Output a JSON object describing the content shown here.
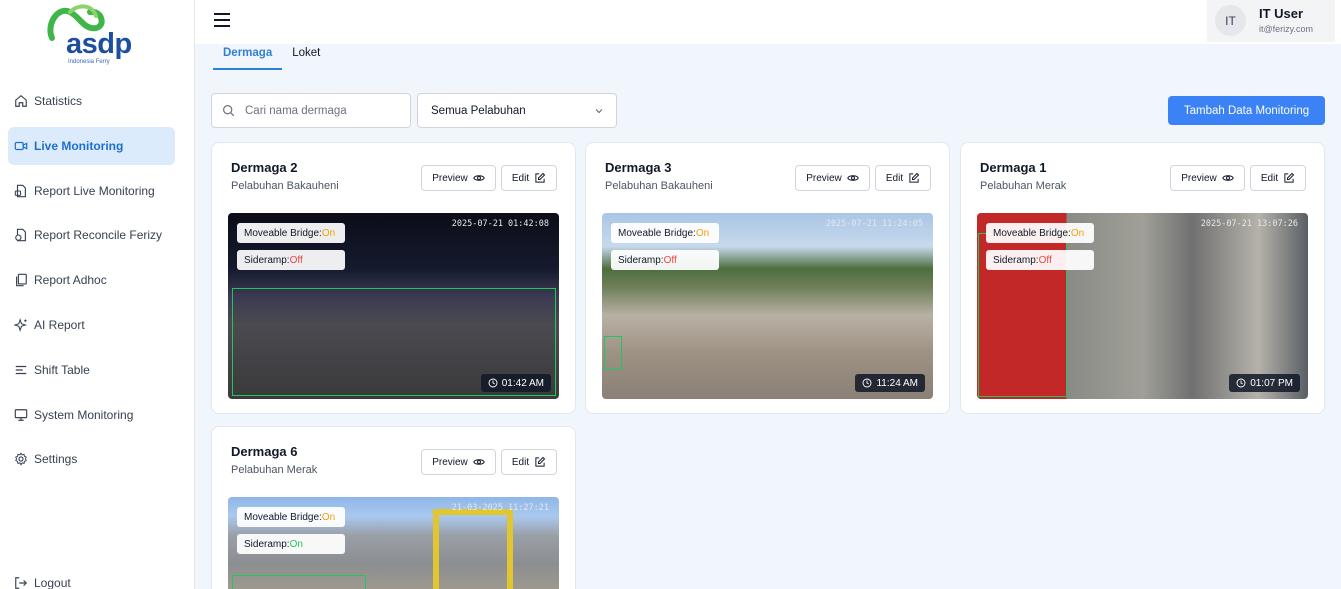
{
  "brand": {
    "name": "asdp",
    "tagline": "Indonesia Ferry"
  },
  "sidebar": {
    "items": [
      {
        "label": "Statistics",
        "icon": "home-icon",
        "active": false
      },
      {
        "label": "Live Monitoring",
        "icon": "video-icon",
        "active": true
      },
      {
        "label": "Report Live Monitoring",
        "icon": "report-icon",
        "active": false
      },
      {
        "label": "Report Reconcile Ferizy",
        "icon": "reconcile-icon",
        "active": false
      },
      {
        "label": "Report Adhoc",
        "icon": "copy-icon",
        "active": false
      },
      {
        "label": "AI Report",
        "icon": "sparkle-icon",
        "active": false
      },
      {
        "label": "Shift Table",
        "icon": "list-icon",
        "active": false
      },
      {
        "label": "System Monitoring",
        "icon": "monitor-icon",
        "active": false
      },
      {
        "label": "Settings",
        "icon": "gear-icon",
        "active": false
      }
    ],
    "logout": "Logout"
  },
  "header": {
    "user": {
      "initials": "IT",
      "name": "IT User",
      "email": "it@ferizy.com"
    }
  },
  "tabs": [
    {
      "label": "Dermaga",
      "active": true
    },
    {
      "label": "Loket",
      "active": false
    }
  ],
  "toolbar": {
    "search_placeholder": "Cari nama dermaga",
    "port_filter": "Semua Pelabuhan",
    "add_button": "Tambah Data Monitoring"
  },
  "labels": {
    "preview": "Preview",
    "edit": "Edit",
    "moveable_bridge": "Moveable Bridge:",
    "sideramp": "Sideramp:"
  },
  "cards": [
    {
      "title": "Dermaga 2",
      "port": "Pelabuhan Bakauheni",
      "bridge": "On",
      "sideramp": "Off",
      "time": "01:42 AM",
      "overlay_ts": "2025-07-21 01:42:08"
    },
    {
      "title": "Dermaga 3",
      "port": "Pelabuhan Bakauheni",
      "bridge": "On",
      "sideramp": "Off",
      "time": "11:24 AM",
      "overlay_ts": "2025-07-21 11:24:05"
    },
    {
      "title": "Dermaga 1",
      "port": "Pelabuhan Merak",
      "bridge": "On",
      "sideramp": "Off",
      "time": "01:07 PM",
      "overlay_ts": "2025-07-21 13:07:26"
    },
    {
      "title": "Dermaga 6",
      "port": "Pelabuhan Merak",
      "bridge": "On",
      "sideramp": "On",
      "time": "",
      "overlay_ts": "21-03-2025 11:27:21"
    }
  ],
  "colors": {
    "accent": "#3b82f6",
    "active_nav_bg": "#dcebfb",
    "on_status": "#f59e0b",
    "off_status": "#ef4444",
    "on_green": "#22c55e"
  }
}
